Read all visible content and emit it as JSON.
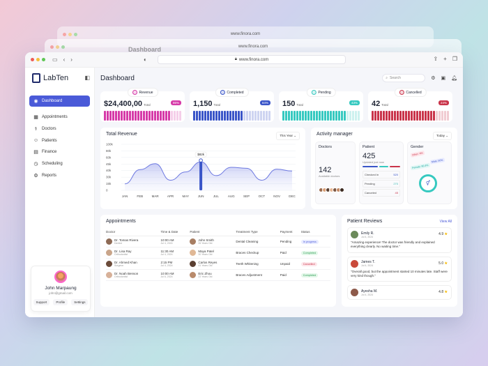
{
  "browser": {
    "url": "www.finora.com",
    "ghost_title": "Dashboard"
  },
  "app": {
    "brand": "LabTen",
    "page_title": "Dashboard",
    "search_placeholder": "Search"
  },
  "sidebar": {
    "items": [
      {
        "label": "Dashboard",
        "icon": "grid-icon",
        "active": true
      },
      {
        "label": "Appointments",
        "icon": "calendar-icon"
      },
      {
        "label": "Doctors",
        "icon": "doctor-icon"
      },
      {
        "label": "Patients",
        "icon": "users-icon"
      },
      {
        "label": "Finance",
        "icon": "finance-icon"
      },
      {
        "label": "Scheduling",
        "icon": "clock-icon"
      },
      {
        "label": "Reports",
        "icon": "report-icon"
      }
    ],
    "profile": {
      "name": "John Marpaung",
      "email": "john@gmail.com",
      "actions": [
        "Support",
        "Profile",
        "Settings"
      ]
    }
  },
  "stats": [
    {
      "tag": "Revenue",
      "value": "$24,400,00",
      "label": "Total",
      "pct": "86%",
      "color": "#d63aa8",
      "fill": 0.86
    },
    {
      "tag": "Completed",
      "value": "1,150",
      "label": "Total",
      "pct": "84%",
      "color": "#3a55c8",
      "fill": 0.64
    },
    {
      "tag": "Pending",
      "value": "150",
      "label": "Total",
      "pct": "43%",
      "color": "#36c9c0",
      "fill": 0.82
    },
    {
      "tag": "Cancelled",
      "value": "42",
      "label": "Total",
      "pct": "24%",
      "color": "#c9344a",
      "fill": 0.82
    }
  ],
  "revenue": {
    "title": "Total Revenue",
    "period": "This Year",
    "tooltip": "$82k"
  },
  "chart_data": {
    "type": "area",
    "title": "Total Revenue",
    "categories": [
      "JAN",
      "FEB",
      "MAR",
      "APR",
      "MAY",
      "JUN",
      "JUL",
      "AUG",
      "SEP",
      "OCT",
      "NOV",
      "DEC"
    ],
    "values": [
      14,
      45,
      58,
      22,
      40,
      62,
      32,
      50,
      48,
      22,
      46,
      42
    ],
    "highlight_index": 5,
    "y_ticks": [
      "100k",
      "80k",
      "60k",
      "45k",
      "40k",
      "30k",
      "15k",
      "0"
    ],
    "ylim": [
      0,
      100
    ]
  },
  "activity": {
    "title": "Activity manager",
    "period": "Today",
    "doctors": {
      "label": "Doctors",
      "value": "142",
      "sub": "Available doctors"
    },
    "patients": {
      "label": "Patient",
      "value": "425",
      "sub": "Updated just now",
      "rows": [
        {
          "k": "Checked In",
          "v": "520"
        },
        {
          "k": "Pending",
          "v": "270"
        },
        {
          "k": "Canceled",
          "v": "45"
        }
      ]
    },
    "gender": {
      "label": "Gender",
      "other": "Other: 4%",
      "male": "Male: 50%",
      "female": "Female: 60.4%"
    }
  },
  "appointments": {
    "title": "Appointments",
    "columns": [
      "Doctor",
      "Time & Date",
      "Patient",
      "Treatment Type",
      "Payment",
      "Status"
    ],
    "rows": [
      {
        "doctor": "Dr. Tomas Rivera",
        "spec": "Dentist",
        "time": "10:00 AM",
        "date": "Jul 4, 2024",
        "patient": "John Smith",
        "patient_age": "26 Years Old",
        "treatment": "Dental Cleaning",
        "payment": "Pending",
        "status": "In progress",
        "status_color": "#4a5ad8",
        "status_bg": "#e8ebff"
      },
      {
        "doctor": "Dr. Lisa Ray",
        "spec": "Orthodontist",
        "time": "11:30 AM",
        "date": "Jul 4, 2024",
        "patient": "Maya Patel",
        "patient_age": "30 Years Old",
        "treatment": "Braces Checkup",
        "payment": "Paid",
        "status": "Completed",
        "status_color": "#2f9e55",
        "status_bg": "#e3f7e9"
      },
      {
        "doctor": "Dr. Ahmed Khan",
        "spec": "Surgeon",
        "time": "2:15 PM",
        "date": "Jul 4, 2024",
        "patient": "Carlos Reyes",
        "patient_age": "41 Years Old",
        "treatment": "Teeth Whitening",
        "payment": "Unpaid",
        "status": "Cancelled",
        "status_color": "#c9344a",
        "status_bg": "#fde6ea"
      },
      {
        "doctor": "Dr. Noah Benson",
        "spec": "Orthodontist",
        "time": "10:00 AM",
        "date": "Jul 6, 2024",
        "patient": "Eric Zhou",
        "patient_age": "22 Years Old",
        "treatment": "Braces Adjustment",
        "payment": "Paid",
        "status": "Completed",
        "status_color": "#2f9e55",
        "status_bg": "#e3f7e9"
      }
    ]
  },
  "reviews": {
    "title": "Patient Reviews",
    "view_all": "View All",
    "items": [
      {
        "name": "Emily R.",
        "date": "Jul 4, 2024",
        "score": "4.9",
        "text": "\"Amazing experience! The doctor was friendly and explained everything clearly. No waiting time.\""
      },
      {
        "name": "James T.",
        "date": "Jul 4, 2024",
        "score": "5.0",
        "text": "\"Overall good, but the appointment started 10 minutes late. Staff were very kind though.\""
      },
      {
        "name": "Ayesha M.",
        "date": "Jul 4, 2024",
        "score": "4.8",
        "text": ""
      }
    ]
  }
}
